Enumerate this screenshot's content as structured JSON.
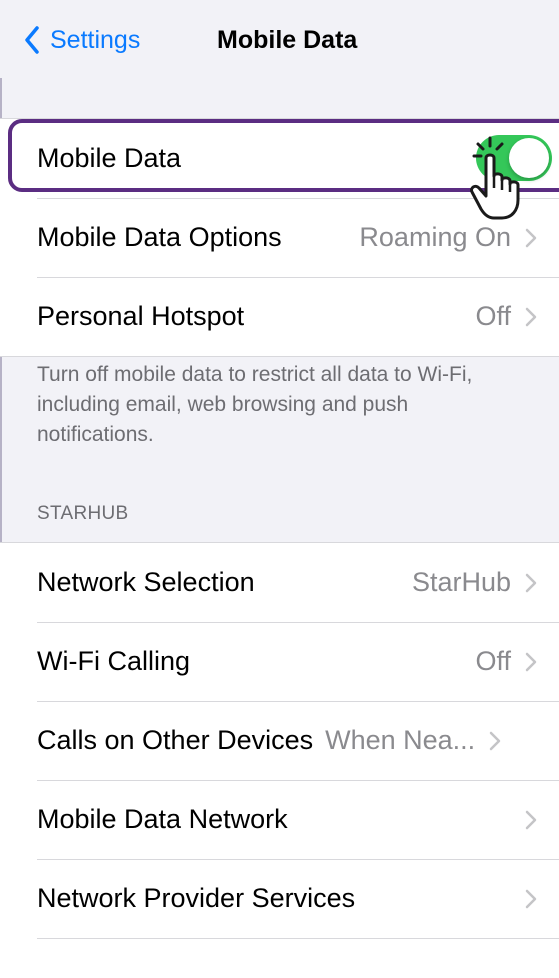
{
  "nav": {
    "back_label": "Settings",
    "title": "Mobile Data"
  },
  "group1": {
    "rows": [
      {
        "label": "Mobile Data",
        "toggle_on": true
      },
      {
        "label": "Mobile Data Options",
        "value": "Roaming On"
      },
      {
        "label": "Personal Hotspot",
        "value": "Off"
      }
    ]
  },
  "footnote": "Turn off mobile data to restrict all data to Wi-Fi, including email, web browsing and push notifications.",
  "section_header": "STARHUB",
  "group2": {
    "rows": [
      {
        "label": "Network Selection",
        "value": "StarHub"
      },
      {
        "label": "Wi-Fi Calling",
        "value": "Off"
      },
      {
        "label": "Calls on Other Devices",
        "value": "When Nea..."
      },
      {
        "label": "Mobile Data Network",
        "value": ""
      },
      {
        "label": "Network Provider Services",
        "value": ""
      }
    ]
  },
  "colors": {
    "accent": "#0a7aff",
    "toggle_on": "#34c759",
    "highlight": "#5b2d82",
    "background": "#f2f2f7"
  },
  "icons": [
    "chevron-left-icon",
    "chevron-right-icon",
    "hand-pointer-icon"
  ]
}
